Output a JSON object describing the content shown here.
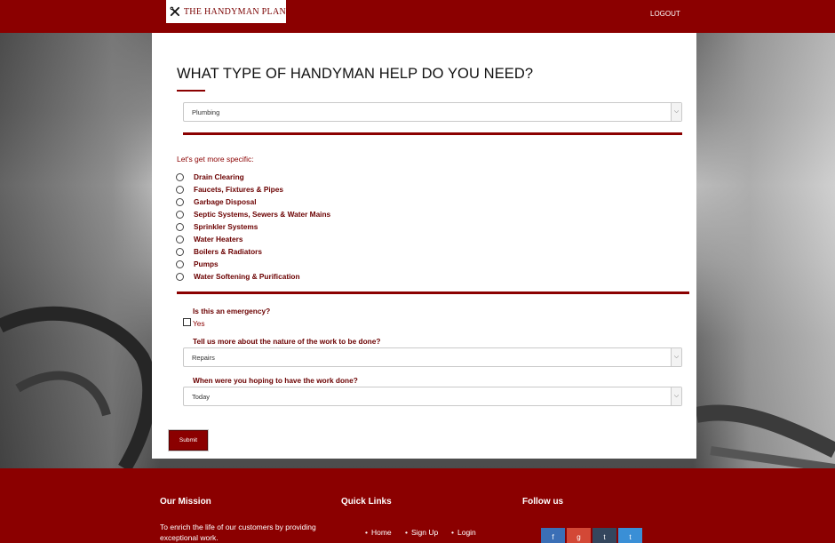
{
  "header": {
    "logo_text": "THE HANDYMAN PLAN",
    "logout_label": "LOGOUT"
  },
  "form": {
    "title": "WHAT TYPE OF HANDYMAN HELP DO YOU NEED?",
    "category_selected": "Plumbing",
    "specific_prompt": "Let's get more specific:",
    "options": [
      "Drain Clearing",
      "Faucets, Fixtures & Pipes",
      "Garbage Disposal",
      "Septic Systems, Sewers & Water Mains",
      "Sprinkler Systems",
      "Water Heaters",
      "Boilers & Radiators",
      "Pumps",
      "Water Softening & Purification"
    ],
    "emergency_question": "Is this an emergency?",
    "emergency_yes": "Yes",
    "nature_question": "Tell us more about the nature of the work to be done?",
    "nature_selected": "Repairs",
    "when_question": "When were you hoping to have the work done?",
    "when_selected": "Today",
    "submit_label": "Submit"
  },
  "footer": {
    "mission_heading": "Our Mission",
    "mission_text": "To enrich the life of our customers by providing exceptional work.",
    "links_heading": "Quick Links",
    "links": [
      "Home",
      "Sign Up",
      "Login"
    ],
    "follow_heading": "Follow us",
    "social": [
      {
        "icon": "facebook-icon",
        "glyph": "f",
        "color": "#3b6fb6"
      },
      {
        "icon": "google-plus-icon",
        "glyph": "g",
        "color": "#d34836"
      },
      {
        "icon": "tumblr-icon",
        "glyph": "t",
        "color": "#34465d"
      },
      {
        "icon": "twitter-icon",
        "glyph": "t",
        "color": "#3a8fd6"
      }
    ]
  },
  "colors": {
    "brand": "#8b0000",
    "label": "#6b0000"
  }
}
